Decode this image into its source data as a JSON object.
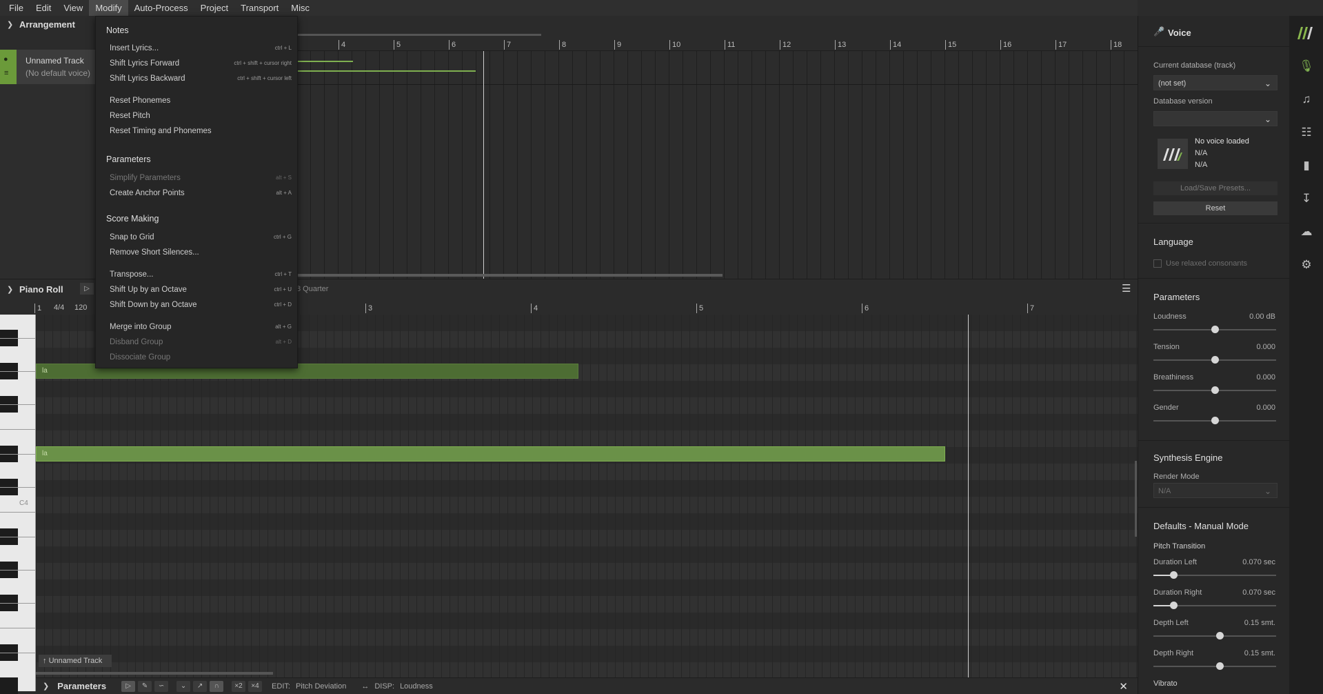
{
  "menubar": {
    "items": [
      "File",
      "Edit",
      "View",
      "Modify",
      "Auto-Process",
      "Project",
      "Transport",
      "Misc"
    ]
  },
  "arrangement": {
    "title": "Arrangement",
    "track": {
      "name": "Unnamed Track",
      "voice": "(No default voice)"
    },
    "ruler": [
      "4",
      "5",
      "6",
      "7",
      "8",
      "9",
      "10",
      "11",
      "12",
      "13",
      "14",
      "15",
      "16",
      "17",
      "18"
    ]
  },
  "pianoroll": {
    "title": "Piano Roll",
    "quantize": "8 Quarter",
    "time_sig": "4/4",
    "tempo": "120",
    "ruler": [
      "1",
      "3",
      "4",
      "5",
      "6",
      "7"
    ],
    "key_label": "C4",
    "notes": [
      "la",
      "la"
    ],
    "track_tag": "Unnamed Track"
  },
  "params": {
    "title": "Parameters",
    "edit_label": "EDIT:",
    "edit_value": "Pitch Deviation",
    "disp_label": "DISP:",
    "disp_value": "Loudness",
    "x2": "×2",
    "x4": "×4"
  },
  "dropdown": {
    "notes_header": "Notes",
    "insert_lyrics": "Insert Lyrics...",
    "insert_lyrics_sc": "ctrl + L",
    "shift_fwd": "Shift Lyrics Forward",
    "shift_fwd_sc": "ctrl + shift + cursor right",
    "shift_back": "Shift Lyrics Backward",
    "shift_back_sc": "ctrl + shift + cursor left",
    "reset_phonemes": "Reset Phonemes",
    "reset_pitch": "Reset Pitch",
    "reset_timing": "Reset Timing and Phonemes",
    "params_header": "Parameters",
    "simplify": "Simplify Parameters",
    "simplify_sc": "alt + S",
    "anchor": "Create Anchor Points",
    "anchor_sc": "alt + A",
    "score_header": "Score Making",
    "snap": "Snap to Grid",
    "snap_sc": "ctrl + G",
    "remove_silences": "Remove Short Silences...",
    "transpose": "Transpose...",
    "transpose_sc": "ctrl + T",
    "shift_up": "Shift Up by an Octave",
    "shift_up_sc": "ctrl + U",
    "shift_down": "Shift Down by an Octave",
    "shift_down_sc": "ctrl + D",
    "merge": "Merge into Group",
    "merge_sc": "alt + G",
    "disband": "Disband Group",
    "disband_sc": "alt + D",
    "dissociate": "Dissociate Group"
  },
  "voice_panel": {
    "title": "Voice",
    "current_db_label": "Current database (track)",
    "current_db_value": "(not set)",
    "db_version_label": "Database version",
    "db_version_value": "",
    "no_voice": "No voice loaded",
    "na1": "N/A",
    "na2": "N/A",
    "load_presets": "Load/Save Presets...",
    "reset": "Reset",
    "language_title": "Language",
    "relaxed": "Use relaxed consonants",
    "parameters_title": "Parameters",
    "loudness_label": "Loudness",
    "loudness_value": "0.00 dB",
    "loudness_level": 0.5,
    "tension_label": "Tension",
    "tension_value": "0.000",
    "tension_level": 0.5,
    "breathiness_label": "Breathiness",
    "breathiness_value": "0.000",
    "breathiness_level": 0.5,
    "gender_label": "Gender",
    "gender_value": "0.000",
    "gender_level": 0.5,
    "engine_title": "Synthesis Engine",
    "render_mode_label": "Render Mode",
    "render_mode_value": "N/A",
    "defaults_title": "Defaults - Manual Mode",
    "pitch_transition": "Pitch Transition",
    "dur_left_label": "Duration Left",
    "dur_left_value": "0.070 sec",
    "dur_right_label": "Duration Right",
    "dur_right_value": "0.070 sec",
    "depth_left_label": "Depth Left",
    "depth_left_value": "0.15 smt.",
    "depth_right_label": "Depth Right",
    "depth_right_value": "0.15 smt.",
    "vibrato": "Vibrato"
  },
  "colors": {
    "accent": "#6b9a3a",
    "note": "#6a9148"
  }
}
